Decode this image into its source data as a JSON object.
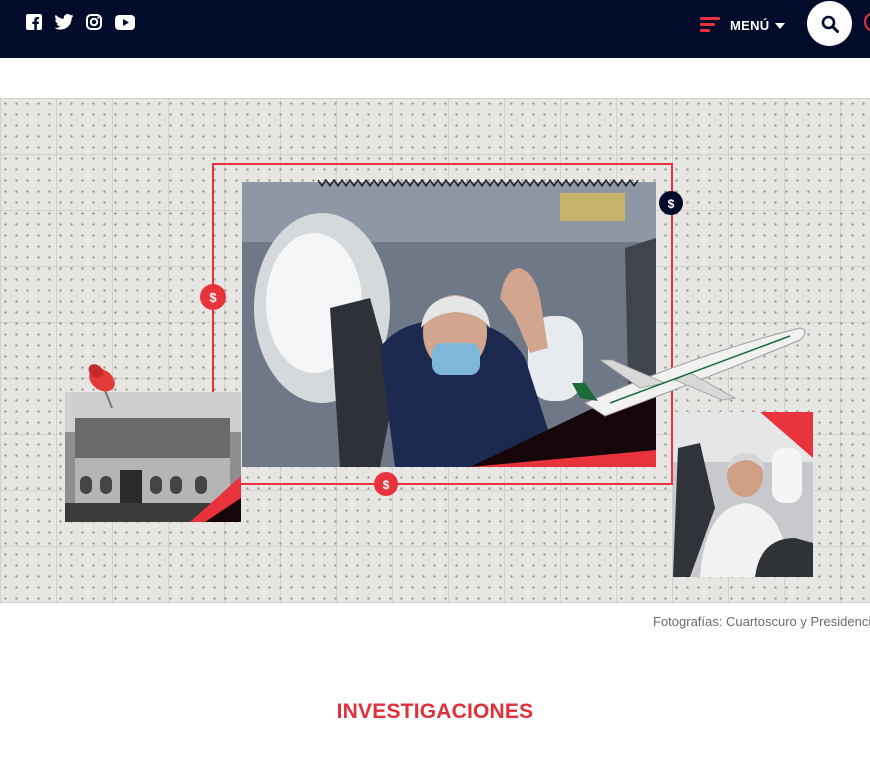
{
  "header": {
    "social": [
      {
        "name": "facebook-icon"
      },
      {
        "name": "twitter-icon"
      },
      {
        "name": "instagram-icon"
      },
      {
        "name": "youtube-icon"
      }
    ],
    "menu_label": "MENÚ",
    "colors": {
      "navy": "#020b2a",
      "accent": "#e8333c"
    }
  },
  "hero": {
    "badges": [
      "$",
      "$",
      "$"
    ],
    "caption": "Fotografías: Cuartoscuro y Presidencia"
  },
  "section": {
    "title": "INVESTIGACIONES"
  }
}
